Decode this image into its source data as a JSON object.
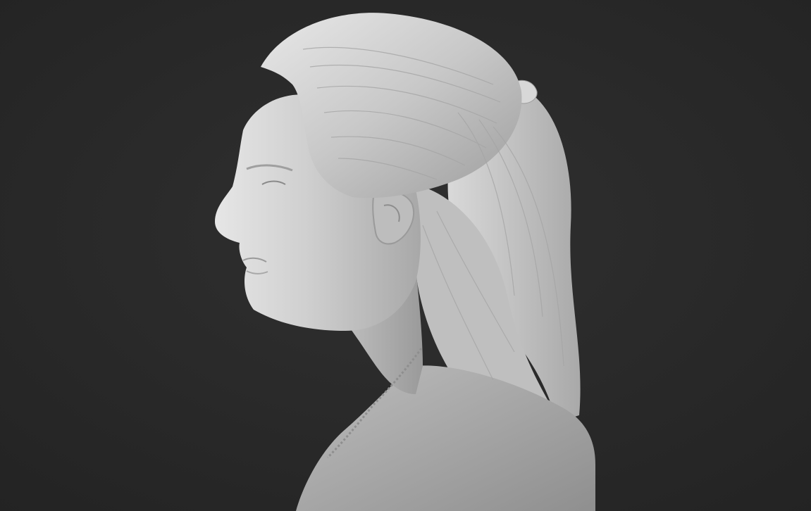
{
  "scene": {
    "background_color": "#2a2a2a",
    "model_color": "#c9c9c9",
    "subject": "bust-sculpture-profile-left"
  }
}
